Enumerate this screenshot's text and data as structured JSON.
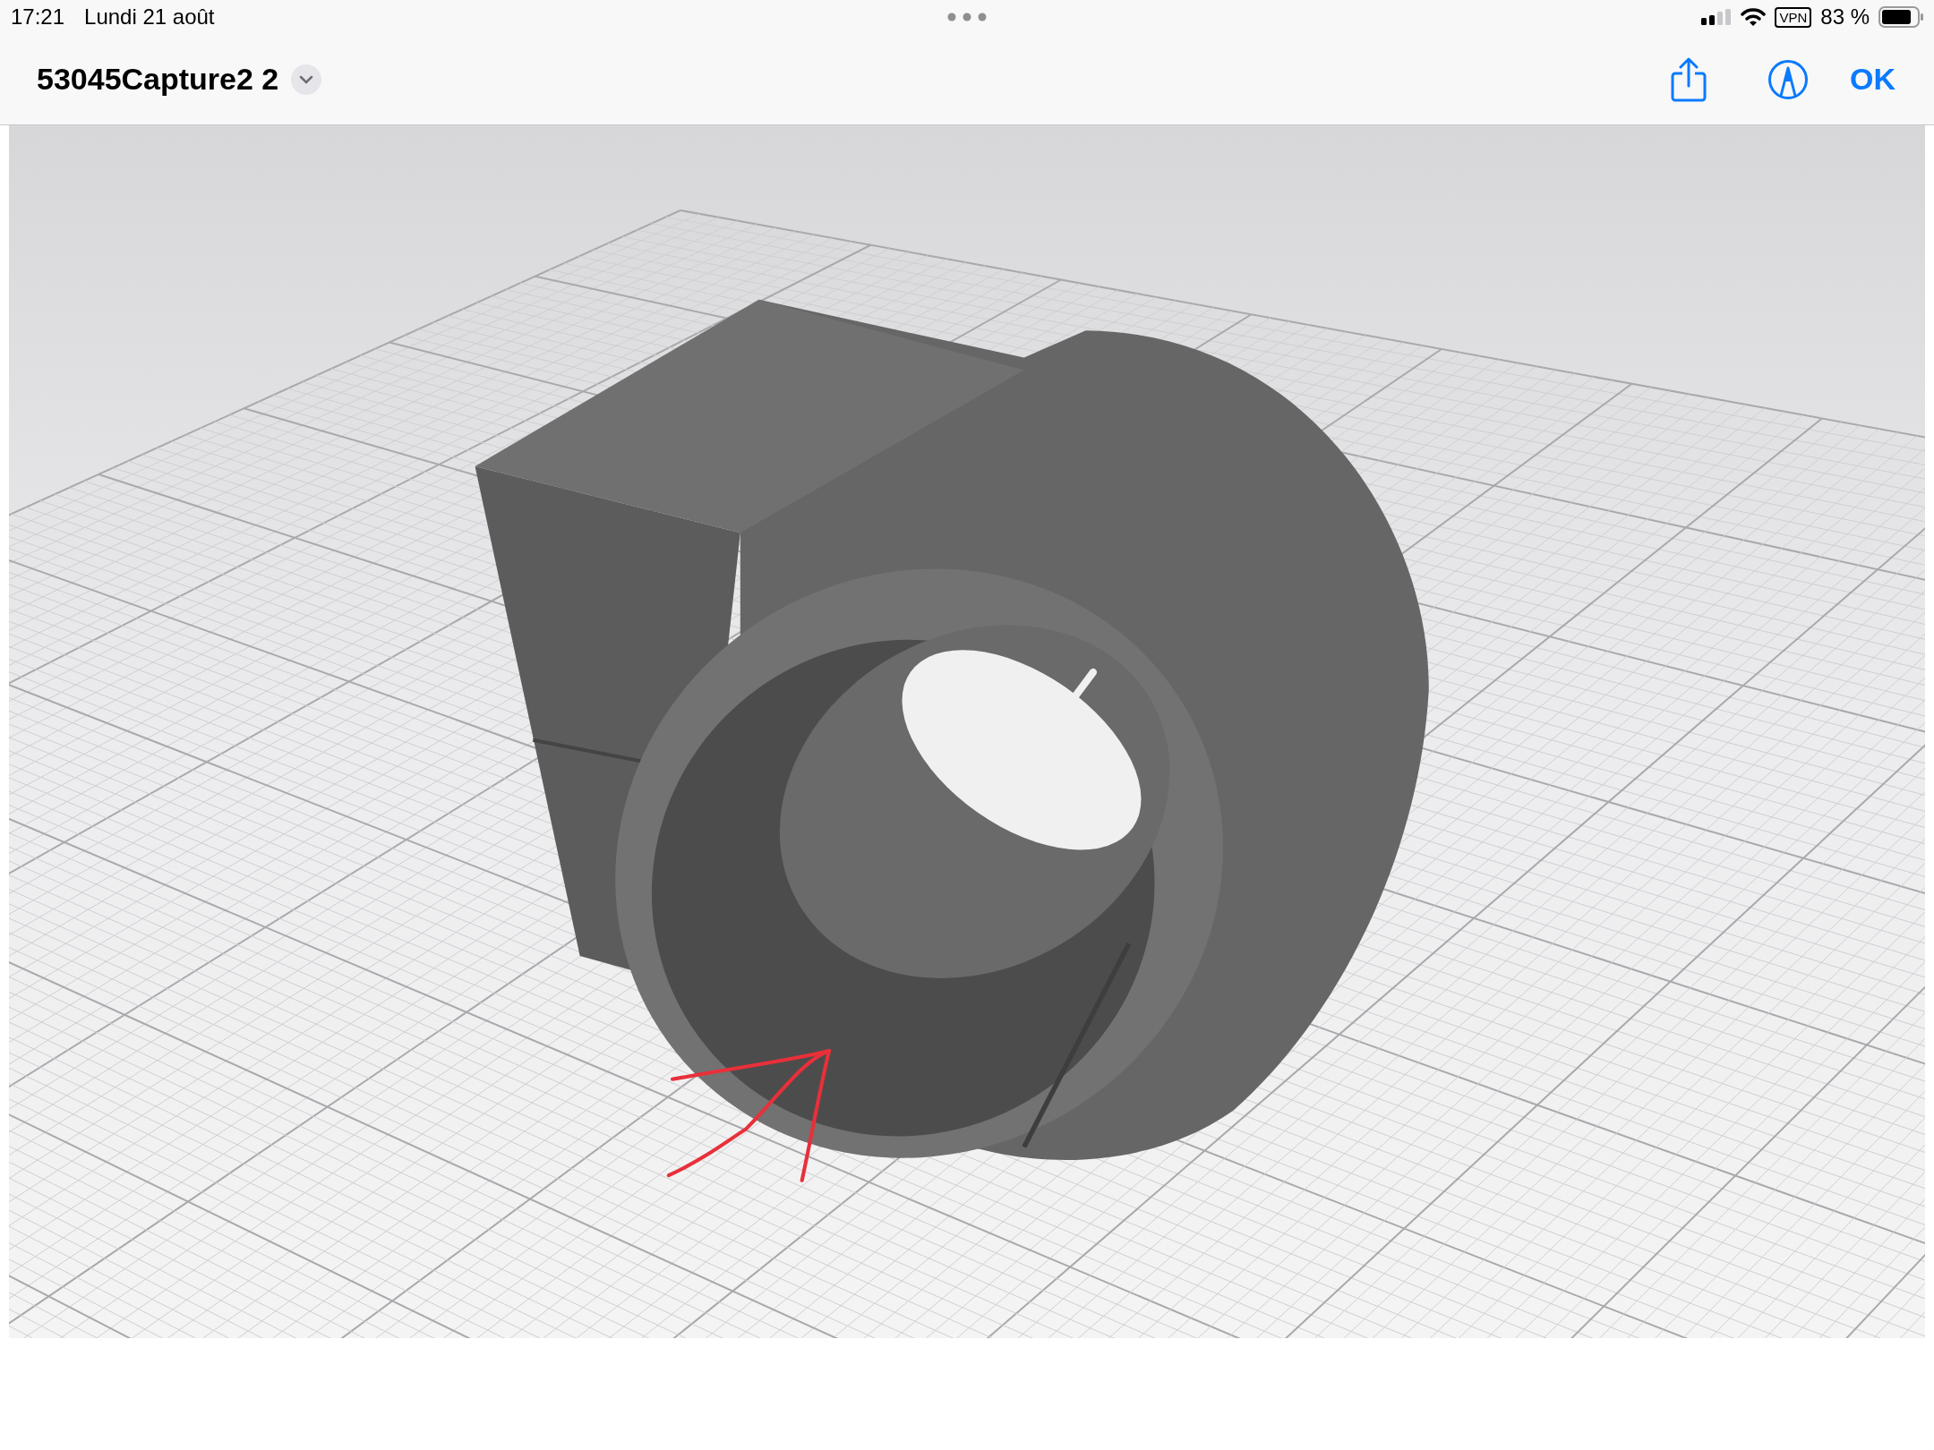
{
  "status_bar": {
    "time": "17:21",
    "date": "Lundi 21 août",
    "vpn": "VPN",
    "battery": "83 %"
  },
  "toolbar": {
    "title": "53045Capture2 2",
    "done": "OK"
  }
}
